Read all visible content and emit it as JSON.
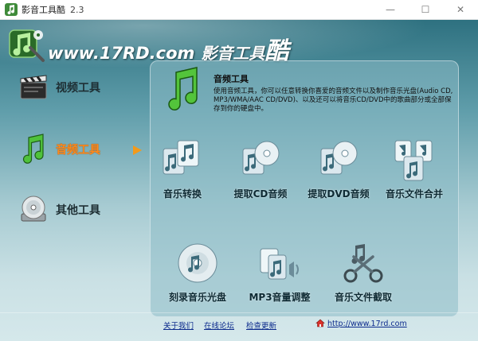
{
  "window": {
    "title": "影音工具酷",
    "version": "2.3",
    "minimize_label": "—",
    "maximize_label": "☐",
    "close_label": "✕"
  },
  "header": {
    "logo_www": "www.17RD.com",
    "logo_brand": "影音工具",
    "logo_brand_big": "酷"
  },
  "sidebar": {
    "items": [
      {
        "label": "视频工具",
        "icon": "clapperboard-icon"
      },
      {
        "label": "音频工具",
        "icon": "music-note-icon",
        "active": true
      },
      {
        "label": "其他工具",
        "icon": "disc-icon"
      }
    ]
  },
  "panel": {
    "title": "音频工具",
    "description": "使用音频工具，你可以任意转换你喜爱的音频文件以及制作音乐光盘(Audio CD, MP3/WMA/AAC CD/DVD)、以及还可以将音乐CD/DVD中的歌曲部分或全部保存到你的硬盘中。",
    "tools": [
      {
        "label": "音乐转换",
        "icon": "music-files-convert-icon"
      },
      {
        "label": "提取CD音频",
        "icon": "cd-audio-extract-icon"
      },
      {
        "label": "提取DVD音频",
        "icon": "dvd-audio-extract-icon"
      },
      {
        "label": "音乐文件合并",
        "icon": "music-files-merge-icon"
      },
      {
        "label": "刻录音乐光盘",
        "icon": "burn-disc-icon"
      },
      {
        "label": "MP3音量调整",
        "icon": "mp3-volume-icon"
      },
      {
        "label": "音乐文件截取",
        "icon": "scissors-cut-icon"
      }
    ]
  },
  "footer": {
    "about": "关于我们",
    "forum": "在线论坛",
    "update": "检查更新",
    "site": "http://www.17rd.com"
  },
  "colors": {
    "accent_orange": "#ff8a1c",
    "link_blue": "#0b2a8c",
    "panel_teal": "#8cbcc6"
  }
}
